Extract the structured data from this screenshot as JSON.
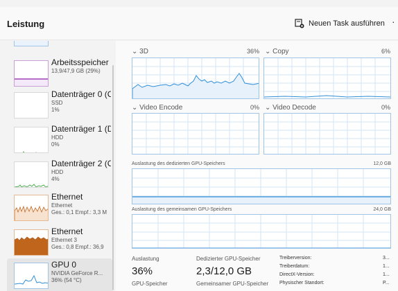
{
  "header": {
    "title": "Leistung",
    "run_task_label": "Neuen Task ausführen"
  },
  "sidebar": {
    "items": [
      {
        "name": "Arbeitsspeicher",
        "sub1": "13,9/47,9 GB (29%)",
        "sub2": ""
      },
      {
        "name": "Datenträger 0 (C",
        "sub1": "SSD",
        "sub2": "1%"
      },
      {
        "name": "Datenträger 1 (D",
        "sub1": "HDD",
        "sub2": "0%"
      },
      {
        "name": "Datenträger 2 (C",
        "sub1": "HDD",
        "sub2": "4%"
      },
      {
        "name": "Ethernet",
        "sub1": "Ethernet",
        "sub2": "Ges.: 0,1 Empf.: 3,3 M"
      },
      {
        "name": "Ethernet",
        "sub1": "Ethernet 3",
        "sub2": "Ges.: 0,8 Empf.: 36,9"
      },
      {
        "name": "GPU 0",
        "sub1": "NVIDIA GeForce R...",
        "sub2": "36% (54 °C)"
      }
    ]
  },
  "gpu": {
    "engines": [
      {
        "name": "3D",
        "percent": "36%"
      },
      {
        "name": "Copy",
        "percent": "6%"
      },
      {
        "name": "Video Encode",
        "percent": "0%"
      },
      {
        "name": "Video Decode",
        "percent": "0%"
      }
    ],
    "dedicated_label": "Auslastung des dedizierten GPU-Speichers",
    "dedicated_max": "12,0 GB",
    "shared_label": "Auslastung des gemeinsamen GPU-Speichers",
    "shared_max": "24,0 GB",
    "stats": {
      "utilization_label": "Auslastung",
      "utilization_value": "36%",
      "dedicated_label": "Dedizierter GPU-Speicher",
      "dedicated_value": "2,3/12,0 GB",
      "gpu_memory_label": "GPU-Speicher",
      "shared_label": "Gemeinsamer GPU-Speicher"
    },
    "properties": [
      {
        "key": "Treiberversion:",
        "value": "3..."
      },
      {
        "key": "Treiberdatum:",
        "value": "1..."
      },
      {
        "key": "DirectX-Version:",
        "value": "1..."
      },
      {
        "key": "Physischer Standort:",
        "value": "P..."
      }
    ]
  },
  "colors": {
    "gpu_line": "#2f8fd8",
    "gpu_grid": "#d3e6f5",
    "memory_line": "#8b1fa8",
    "disk_line": "#4caf50",
    "ethernet_line": "#c0651c"
  }
}
